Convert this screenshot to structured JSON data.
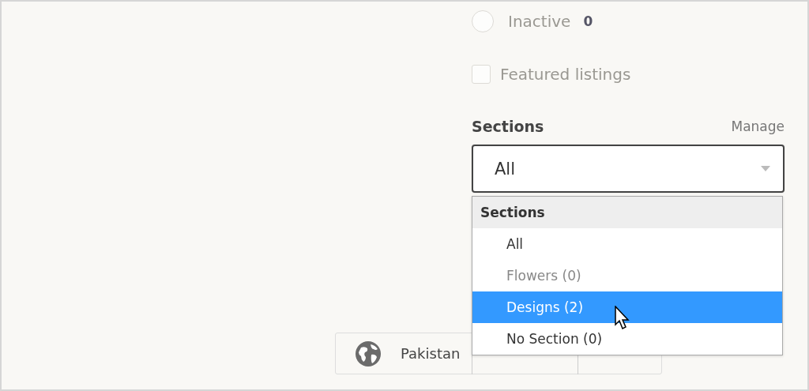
{
  "filters": [
    {
      "kind": "radio",
      "label": "Inactive",
      "count": "0",
      "checked": false,
      "disabled": true
    },
    {
      "kind": "checkbox",
      "label": "Featured listings",
      "checked": false,
      "disabled": true
    }
  ],
  "sections": {
    "title": "Sections",
    "manage_link": "Manage",
    "select": {
      "value": "All",
      "expanded": true
    },
    "menu": {
      "header": "Sections",
      "items": [
        {
          "label": "All",
          "selected": false,
          "disabled": false
        },
        {
          "label": "Flowers (0)",
          "selected": false,
          "disabled": true
        },
        {
          "label": "Designs (2)",
          "selected": true,
          "disabled": false
        },
        {
          "label": "No Section (0)",
          "selected": false,
          "disabled": false
        }
      ]
    }
  },
  "locale": {
    "country": "Pakistan"
  }
}
